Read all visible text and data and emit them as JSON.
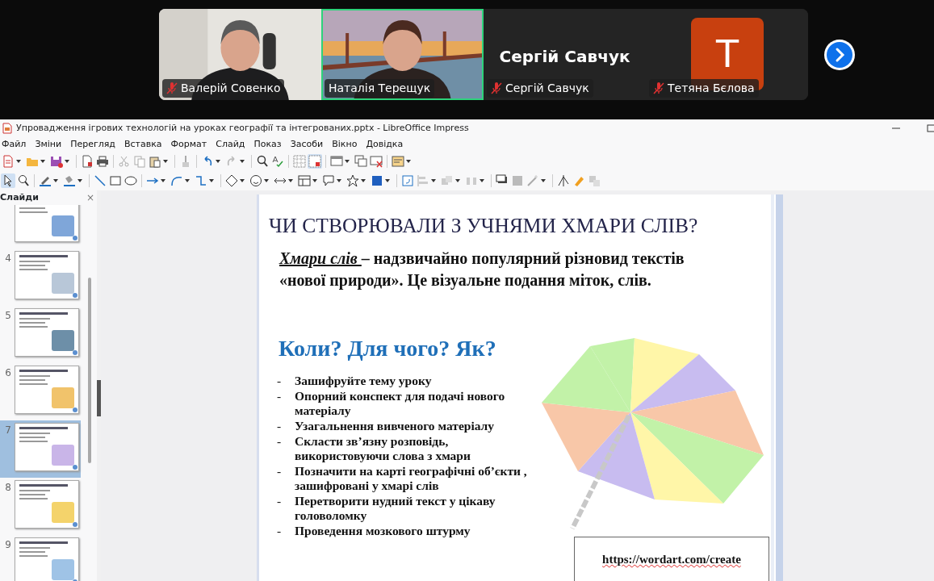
{
  "call": {
    "participants": [
      {
        "name": "Валерій Совенко",
        "kind": "video",
        "muted": true,
        "selected": false
      },
      {
        "name": "Наталія Терещук",
        "kind": "video",
        "muted": false,
        "selected": true
      },
      {
        "name": "Сергій Савчук",
        "kind": "name",
        "title": "Сергій Савчук",
        "muted": true,
        "selected": false
      },
      {
        "name": "Тетяна Бєлова",
        "kind": "avatar",
        "letter": "T",
        "muted": true,
        "selected": false
      }
    ]
  },
  "window": {
    "title": "Упровадження ігрових технологій на уроках географії та інтегрованих.pptx - LibreOffice Impress"
  },
  "menu": [
    "Файл",
    "Зміни",
    "Перегляд",
    "Вставка",
    "Формат",
    "Слайд",
    "Показ",
    "Засоби",
    "Вікно",
    "Довідка"
  ],
  "slides_panel": {
    "title": "Слайди",
    "close": "×",
    "slides": [
      {
        "selected": false
      },
      {
        "number": "4",
        "selected": false
      },
      {
        "number": "5",
        "selected": false
      },
      {
        "number": "6",
        "selected": false
      },
      {
        "number": "7",
        "selected": true
      },
      {
        "number": "8",
        "selected": false
      },
      {
        "number": "9",
        "selected": false
      }
    ]
  },
  "slide": {
    "title": "ЧИ СТВОРЮВАЛИ З УЧНЯМИ ХМАРИ СЛІВ?",
    "intro_term": "Хмари слів ",
    "intro_text": "– надзвичайно  популярний  різновид текстів «нової природи». Це візуальне подання міток, слів.",
    "heading": "Коли? Для чого? Як?",
    "bullets": [
      {
        "marker": "-",
        "text": "Зашифруйте тему уроку"
      },
      {
        "marker": "-",
        "text": "Опорний конспект для подачі нового матеріалу"
      },
      {
        "marker": "-",
        "text": "Узагальнення вивченого матеріалу"
      },
      {
        "marker": "-",
        "text": "Скласти зв’язну розповідь, використовуючи слова з хмари"
      },
      {
        "marker": "-",
        "text": "Позначити на карті географічні об’єкти , зашифровані у хмарі слів"
      },
      {
        "marker": "-",
        "text": "Перетворити нудний текст у цікаву головоломку"
      },
      {
        "marker": "-",
        "text": "Проведення мозкового штурму"
      }
    ],
    "link": "https://wordart.com/create"
  }
}
